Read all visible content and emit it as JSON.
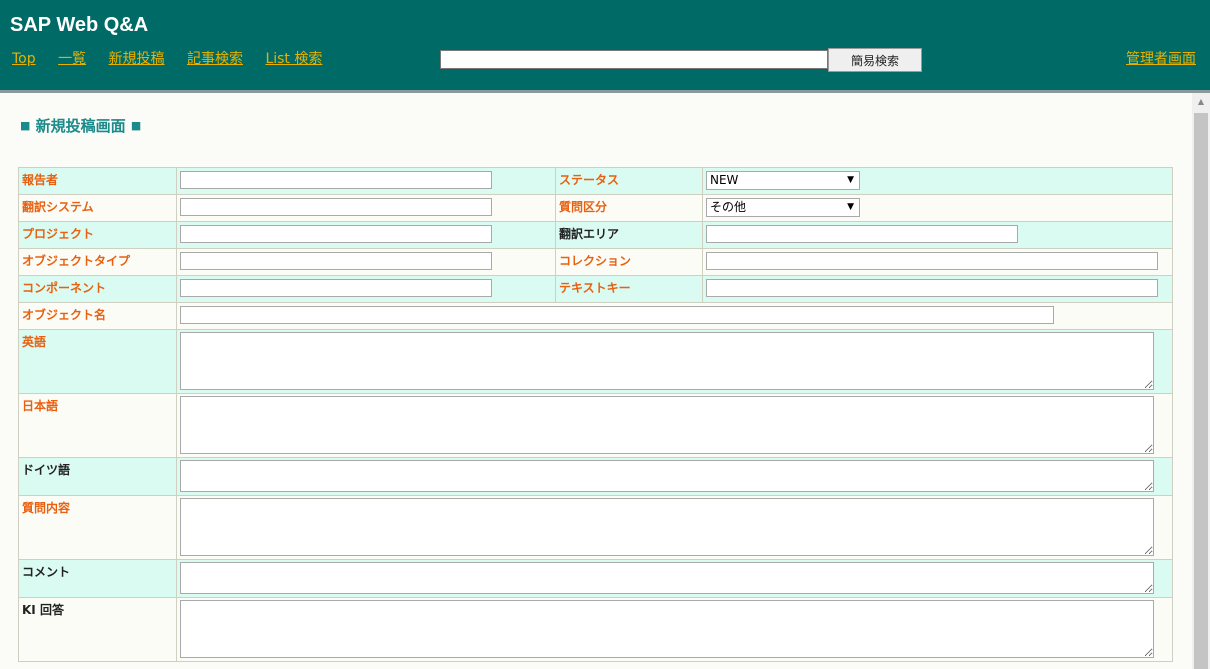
{
  "header": {
    "title": "SAP Web Q&A",
    "nav": [
      "Top",
      "一覧",
      "新規投稿",
      "記事検索",
      "List 検索"
    ],
    "search_button": "簡易検索",
    "admin_link": "管理者画面"
  },
  "page": {
    "title": "新規投稿画面",
    "square": "■"
  },
  "form": {
    "reporter": "報告者",
    "status": "ステータス",
    "status_value": "NEW",
    "translation_system": "翻訳システム",
    "question_type": "質問区分",
    "question_type_value": "その他",
    "project": "プロジェクト",
    "translation_area": "翻訳エリア",
    "object_type": "オブジェクトタイプ",
    "collection": "コレクション",
    "component": "コンポーネント",
    "text_key": "テキストキー",
    "object_name": "オブジェクト名",
    "english": "英語",
    "japanese": "日本語",
    "german": "ドイツ語",
    "question_content": "質問内容",
    "comment": "コメント",
    "ki_answer": "KI 回答"
  },
  "colors": {
    "header_bg": "#006a66",
    "nav_link": "#e8b100",
    "required_label": "#e86010",
    "page_title": "#1a8a8a",
    "row_alt": "#d9fbf2"
  },
  "icons": {
    "dropdown": "triangle-down",
    "scroll_up": "triangle-up"
  }
}
